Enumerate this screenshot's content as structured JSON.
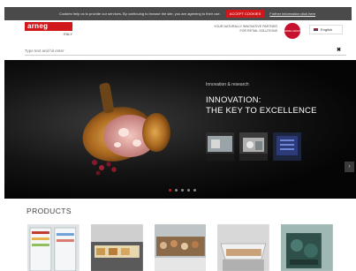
{
  "cookie": {
    "text": "Cookies help us to provide our services. By continuing to browse the site, you are agreeing to their use.",
    "accept_label": "ACCEPT COOKIES",
    "more_label": "Further information click here"
  },
  "header": {
    "logo_text": "arneg",
    "logo_sub": "ITALY",
    "tagline_line1": "YOUR NATURALLY INNOVATIVE PARTNER",
    "tagline_line2": "FOR RETAIL SOLUTIONS",
    "badge_text": "ARNEG GROUP",
    "language": "English"
  },
  "search": {
    "placeholder": "Type text and hit enter",
    "close_glyph": "✖"
  },
  "hero": {
    "kicker": "Innovation & research",
    "title_line1": "INNOVATION:",
    "title_line2": "THE KEY TO EXCELLENCE",
    "slide_count": 5,
    "active_slide": 1,
    "next_glyph": "›"
  },
  "products": {
    "title": "PRODUCTS"
  },
  "colors": {
    "brand_red": "#d0171b",
    "hero_bg": "#0a0a0a"
  }
}
